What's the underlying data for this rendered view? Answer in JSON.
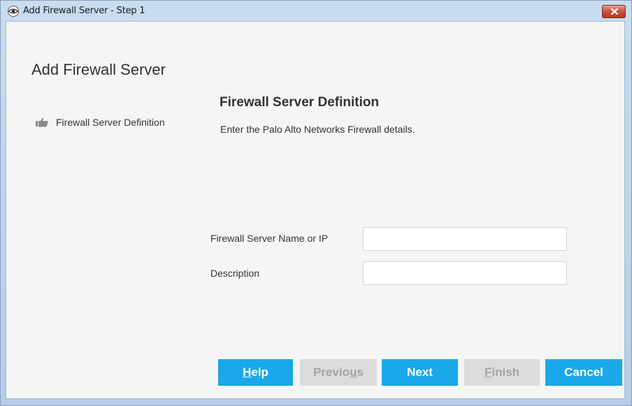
{
  "window": {
    "title": "Add Firewall Server - Step 1"
  },
  "page": {
    "title": "Add Firewall Server"
  },
  "left_nav": {
    "items": [
      {
        "label": "Firewall Server Definition",
        "icon": "pointing-hand-icon",
        "active": true
      }
    ]
  },
  "section": {
    "title": "Firewall Server Definition",
    "description": "Enter the Palo Alto Networks Firewall details."
  },
  "form": {
    "fields": [
      {
        "label": "Firewall Server Name or IP",
        "value": "",
        "placeholder": ""
      },
      {
        "label": "Description",
        "value": "",
        "placeholder": ""
      }
    ]
  },
  "buttons": {
    "help": {
      "pre": "",
      "mnemonic": "H",
      "post": "elp",
      "enabled": true
    },
    "previous": {
      "pre": "Previo",
      "mnemonic": "u",
      "post": "s",
      "enabled": false
    },
    "next": {
      "pre": "Next",
      "mnemonic": "",
      "post": "",
      "enabled": true
    },
    "finish": {
      "pre": "",
      "mnemonic": "F",
      "post": "inish",
      "enabled": false
    },
    "cancel": {
      "pre": "Cancel",
      "mnemonic": "",
      "post": "",
      "enabled": true
    }
  },
  "colors": {
    "accent": "#1ba8e8",
    "disabled_bg": "#dcdcdc",
    "disabled_text": "#a3a3a3",
    "close_button": "#c9503d"
  }
}
